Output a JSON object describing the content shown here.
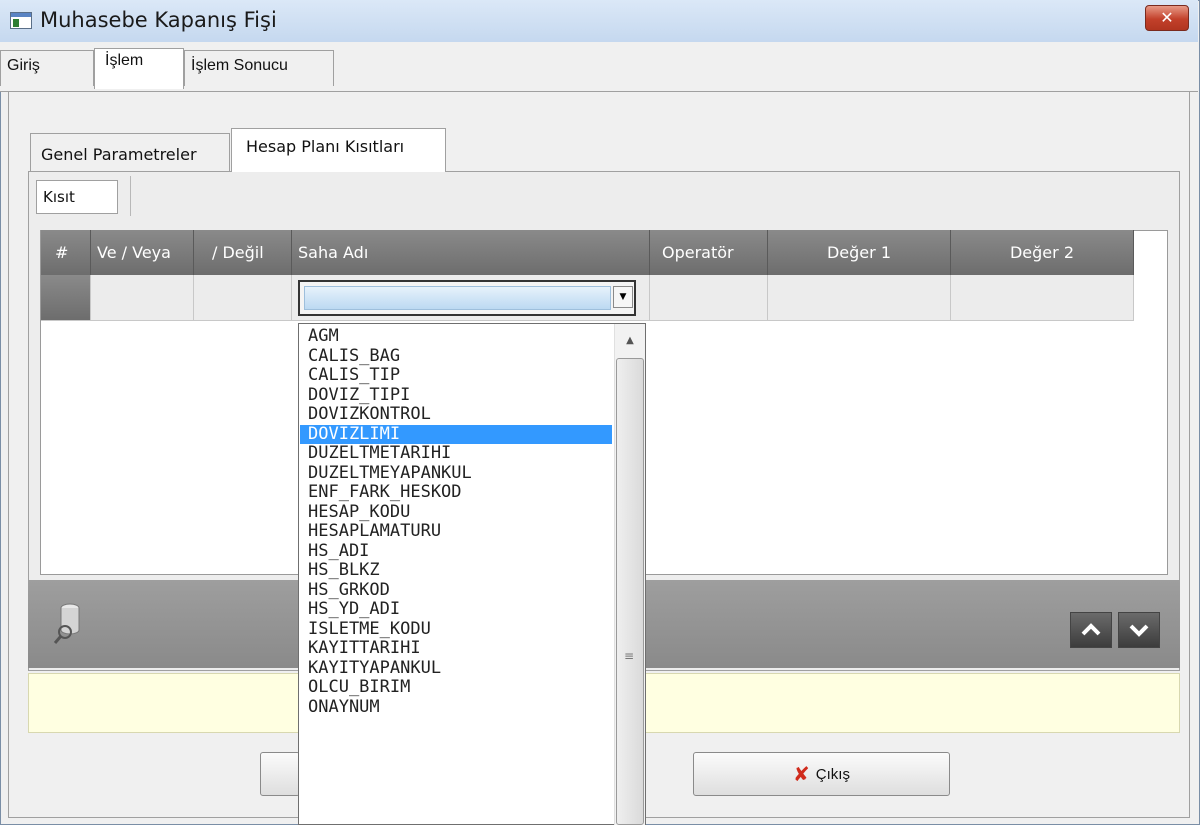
{
  "window": {
    "title": "Muhasebe Kapanış Fişi",
    "close_label": "x"
  },
  "top_tabs": [
    {
      "label": "Giriş"
    },
    {
      "label": "İşlem"
    },
    {
      "label": "İşlem Sonucu"
    }
  ],
  "inner_tabs": [
    {
      "label": "Genel Parametreler"
    },
    {
      "label": "Hesap Planı Kısıtları"
    }
  ],
  "sub_tab": {
    "label": "Kısıt"
  },
  "grid": {
    "columns": [
      "#",
      "Ve / Veya",
      "/ Değil",
      "Saha Adı",
      "Operatör",
      "Değer 1",
      "Değer 2"
    ]
  },
  "dropdown": {
    "items": [
      "AGM",
      "CALIS_BAG",
      "CALIS_TIP",
      "DOVIZ_TIPI",
      "DOVIZKONTROL",
      "DOVIZLIMI",
      "DUZELTMETARIHI",
      "DUZELTMEYAPANKUL",
      "ENF_FARK_HESKOD",
      "HESAP_KODU",
      "HESAPLAMATURU",
      "HS_ADI",
      "HS_BLKZ",
      "HS_GRKOD",
      "HS_YD_ADI",
      "ISLETME_KODU",
      "KAYITTARIHI",
      "KAYITYAPANKUL",
      "OLCU_BIRIM",
      "ONAYNUM"
    ],
    "selected": "DOVIZLIMI"
  },
  "buttons": {
    "exit_label": "Çıkış"
  },
  "colors": {
    "selection": "#3399ff",
    "header_bg": "#7a7a7a",
    "status_bg": "#ffffe1",
    "close_red": "#c2402a"
  },
  "icons": {
    "close": "close-icon",
    "query": "database-search-icon",
    "up": "chevron-up-icon",
    "down": "chevron-down-icon",
    "exit": "x-mark-icon"
  }
}
